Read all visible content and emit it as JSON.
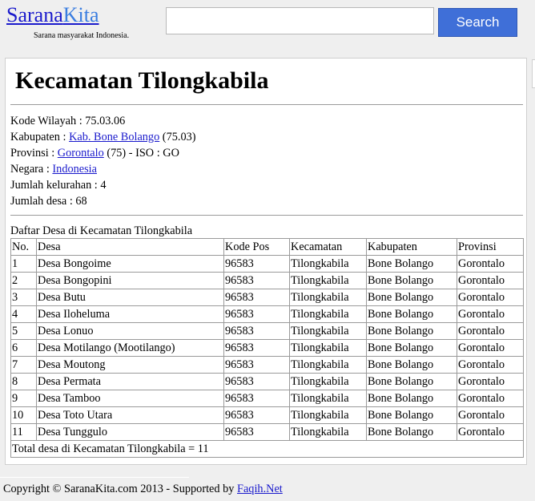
{
  "header": {
    "logo_part1": "Sarana",
    "logo_part2": "Kita",
    "tagline": "Sarana masyarakat Indonesia.",
    "search_placeholder": "",
    "search_value": "",
    "search_label": "Search"
  },
  "page": {
    "title": "Kecamatan Tilongkabila"
  },
  "info": {
    "kode_label": "Kode Wilayah : ",
    "kode_value": "75.03.06",
    "kabupaten_label": "Kabupaten : ",
    "kabupaten_link": "Kab. Bone Bolango",
    "kabupaten_code": " (75.03)",
    "provinsi_label": "Provinsi : ",
    "provinsi_link": "Gorontalo",
    "provinsi_suffix": " (75) - ISO : GO",
    "negara_label": "Negara : ",
    "negara_link": "Indonesia",
    "kelurahan_text": "Jumlah kelurahan : 4",
    "desa_text": "Jumlah desa : 68"
  },
  "table": {
    "caption": "Daftar Desa di Kecamatan Tilongkabila",
    "headers": [
      "No.",
      "Desa",
      "Kode Pos",
      "Kecamatan",
      "Kabupaten",
      "Provinsi"
    ],
    "rows": [
      [
        "1",
        "Desa Bongoime",
        "96583",
        "Tilongkabila",
        "Bone Bolango",
        "Gorontalo"
      ],
      [
        "2",
        "Desa Bongopini",
        "96583",
        "Tilongkabila",
        "Bone Bolango",
        "Gorontalo"
      ],
      [
        "3",
        "Desa Butu",
        "96583",
        "Tilongkabila",
        "Bone Bolango",
        "Gorontalo"
      ],
      [
        "4",
        "Desa Iloheluma",
        "96583",
        "Tilongkabila",
        "Bone Bolango",
        "Gorontalo"
      ],
      [
        "5",
        "Desa Lonuo",
        "96583",
        "Tilongkabila",
        "Bone Bolango",
        "Gorontalo"
      ],
      [
        "6",
        "Desa Motilango (Mootilango)",
        "96583",
        "Tilongkabila",
        "Bone Bolango",
        "Gorontalo"
      ],
      [
        "7",
        "Desa Moutong",
        "96583",
        "Tilongkabila",
        "Bone Bolango",
        "Gorontalo"
      ],
      [
        "8",
        "Desa Permata",
        "96583",
        "Tilongkabila",
        "Bone Bolango",
        "Gorontalo"
      ],
      [
        "9",
        "Desa Tamboo",
        "96583",
        "Tilongkabila",
        "Bone Bolango",
        "Gorontalo"
      ],
      [
        "10",
        "Desa Toto Utara",
        "96583",
        "Tilongkabila",
        "Bone Bolango",
        "Gorontalo"
      ],
      [
        "11",
        "Desa Tunggulo",
        "96583",
        "Tilongkabila",
        "Bone Bolango",
        "Gorontalo"
      ]
    ],
    "total": "Total desa di Kecamatan Tilongkabila = 11"
  },
  "footer": {
    "text": "Copyright © SaranaKita.com 2013 - Supported by ",
    "link": "Faqih.Net"
  }
}
